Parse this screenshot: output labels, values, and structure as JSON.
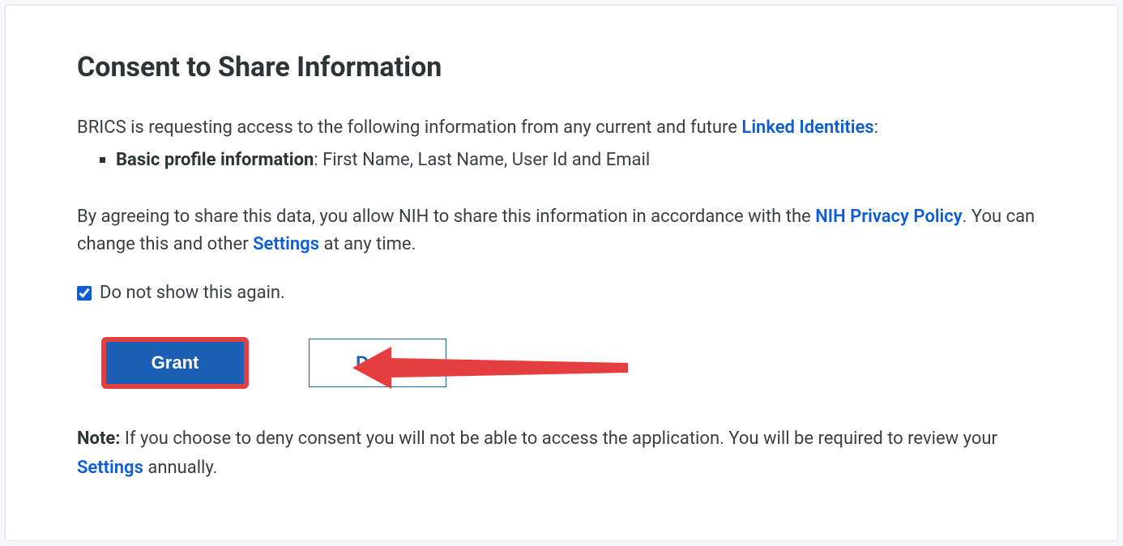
{
  "heading": "Consent to Share Information",
  "intro": {
    "prefix": "BRICS is requesting access to the following information from any current and future ",
    "link": "Linked Identities",
    "suffix": ":"
  },
  "bullet": {
    "label": "Basic profile information",
    "detail": ": First Name, Last Name, User Id and Email"
  },
  "agreement": {
    "part1": "By agreeing to share this data, you allow NIH to share this information in accordance with the ",
    "privacy_link": "NIH Privacy Policy",
    "part2": ". You can change this and other ",
    "settings_link": "Settings",
    "part3": " at any time."
  },
  "checkbox_label": "Do not show this again.",
  "buttons": {
    "grant": "Grant",
    "deny": "Deny"
  },
  "note": {
    "label": "Note:",
    "text1": " If you choose to deny consent you will not be able to access the application. You will be required to review your ",
    "settings_link": "Settings",
    "text2": " annually."
  }
}
